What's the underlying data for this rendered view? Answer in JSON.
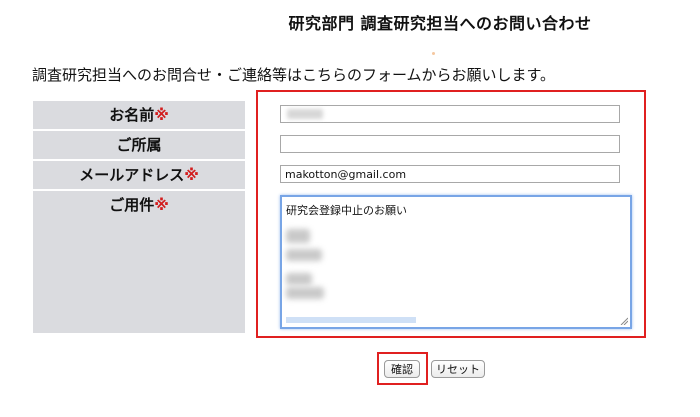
{
  "page": {
    "title": "研究部門 調査研究担当へのお問い合わせ",
    "intro": "調査研究担当へのお問合せ・ご連絡等はこちらのフォームからお願いします。"
  },
  "form": {
    "name": {
      "label": "お名前",
      "required_mark": "※",
      "value": ""
    },
    "affiliation": {
      "label": "ご所属",
      "value": ""
    },
    "email": {
      "label": "メールアドレス",
      "required_mark": "※",
      "value": "makotton@gmail.com"
    },
    "message": {
      "label": "ご用件",
      "required_mark": "※",
      "first_line": "研究会登録中止のお願い"
    }
  },
  "buttons": {
    "confirm_label": "確認",
    "reset_label": "リセット"
  },
  "colors": {
    "label_background": "#dadbdf",
    "required_mark": "#d21e1e",
    "highlight_border": "#e02020",
    "focus_border": "#78a5e6"
  }
}
